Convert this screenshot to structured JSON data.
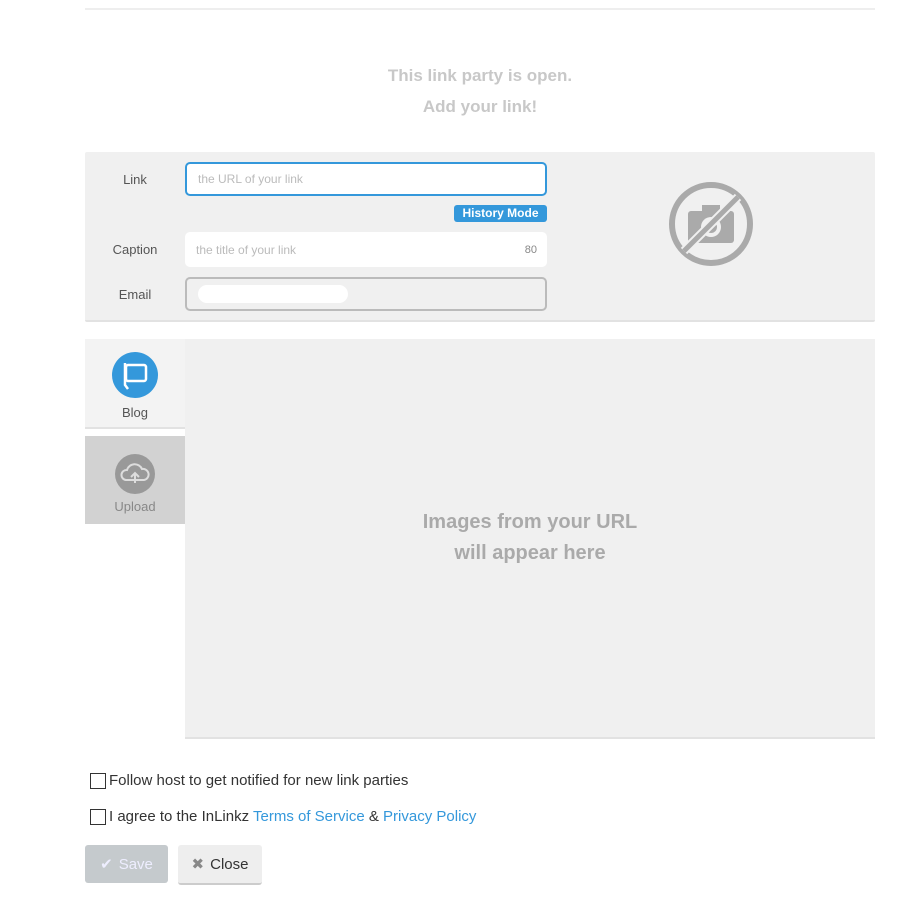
{
  "header": {
    "line1": "This link party is open.",
    "line2": "Add your link!"
  },
  "form": {
    "link_label": "Link",
    "link_placeholder": "the URL of your link",
    "history_mode": "History Mode",
    "caption_label": "Caption",
    "caption_placeholder": "the title of your link",
    "caption_counter": "80",
    "email_label": "Email",
    "email_value": ""
  },
  "tabs": [
    {
      "label": "Blog",
      "icon": "blog-icon",
      "active": true
    },
    {
      "label": "Upload",
      "icon": "cloud-upload-icon",
      "active": false
    }
  ],
  "preview": {
    "line1": "Images from your URL",
    "line2": "will appear here",
    "thumbnail_icon": "no-camera-icon"
  },
  "options": {
    "follow": "Follow host to get notified for new link parties",
    "agree_prefix": "I agree to the InLinkz ",
    "terms": "Terms of Service",
    "amp": " & ",
    "privacy": "Privacy Policy"
  },
  "buttons": {
    "save": "Save",
    "close": "Close"
  },
  "colors": {
    "accent": "#3498db"
  }
}
